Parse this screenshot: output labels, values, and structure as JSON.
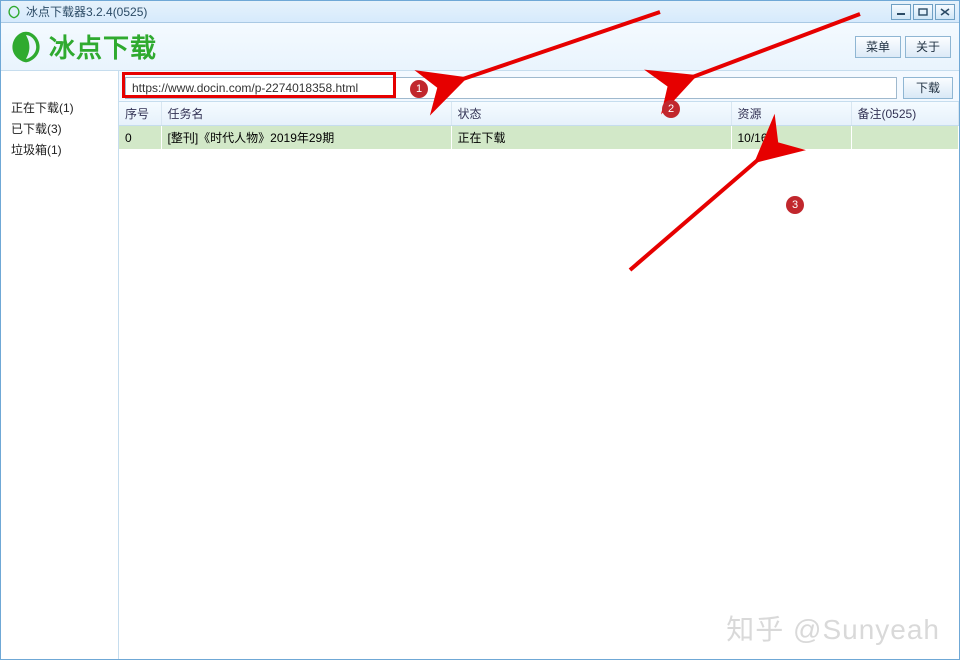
{
  "window": {
    "title": "冰点下载器3.2.4(0525)"
  },
  "brand": {
    "title": "冰点下载",
    "menu_label": "菜单",
    "about_label": "关于"
  },
  "sidebar": {
    "items": [
      {
        "label": "正在下载(1)"
      },
      {
        "label": "已下载(3)"
      },
      {
        "label": "垃圾箱(1)"
      }
    ]
  },
  "url": {
    "value": "https://www.docin.com/p-2274018358.html",
    "download_label": "下载"
  },
  "table": {
    "headers": {
      "index": "序号",
      "task": "任务名",
      "state": "状态",
      "resource": "资源",
      "note": "备注(0525)"
    },
    "rows": [
      {
        "index": "0",
        "task": "[整刊]《时代人物》2019年29期",
        "state": "正在下载",
        "resource": "10/166",
        "note": ""
      }
    ]
  },
  "annotations": {
    "badges": {
      "1": "1",
      "2": "2",
      "3": "3"
    }
  },
  "watermark": "知乎 @Sunyeah"
}
